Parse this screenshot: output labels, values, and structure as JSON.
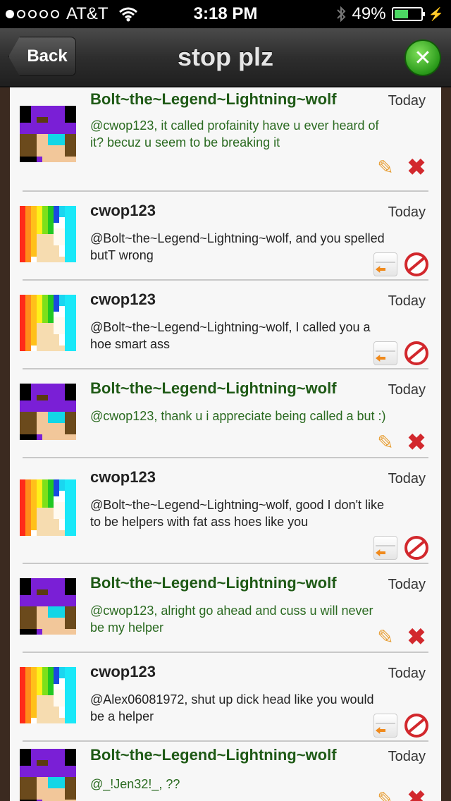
{
  "status_bar": {
    "signal_dots": 5,
    "signal_filled": 1,
    "carrier": "AT&T",
    "time": "3:18 PM",
    "battery": "49%"
  },
  "nav": {
    "back_label": "Back",
    "title": "stop plz",
    "settings_icon": "wrench-screwdriver-icon"
  },
  "colors": {
    "self_name": "#1f5a16",
    "self_text": "#2a6a20",
    "other_name": "#222222",
    "delete_red": "#d2282d",
    "reply_orange": "#f08a1c"
  },
  "messages": [
    {
      "author": "Bolt~the~Legend~Lightning~wolf",
      "time": "Today",
      "text": "@cwop123, it called profainity have u ever heard of it? becuz u seem to be breaking it",
      "own": true
    },
    {
      "author": "cwop123",
      "time": "Today",
      "text": "@Bolt~the~Legend~Lightning~wolf, and you spelled butT wrong",
      "own": false
    },
    {
      "author": "cwop123",
      "time": "Today",
      "text": "@Bolt~the~Legend~Lightning~wolf, I called you a hoe smart ass",
      "own": false
    },
    {
      "author": "Bolt~the~Legend~Lightning~wolf",
      "time": "Today",
      "text": "@cwop123, thank u i appreciate being called a but :)",
      "own": true
    },
    {
      "author": "cwop123",
      "time": "Today",
      "text": "@Bolt~the~Legend~Lightning~wolf, good I don't like to be helpers with fat ass hoes like you",
      "own": false
    },
    {
      "author": "Bolt~the~Legend~Lightning~wolf",
      "time": "Today",
      "text": "@cwop123, alright go ahead and cuss u will never be my helper",
      "own": true
    },
    {
      "author": "cwop123",
      "time": "Today",
      "text": "@Alex06081972, shut up dick head like you would be a helper",
      "own": false
    },
    {
      "author": "Bolt~the~Legend~Lightning~wolf",
      "time": "Today",
      "text": "@_!Jen32!_, ??",
      "own": true
    }
  ]
}
